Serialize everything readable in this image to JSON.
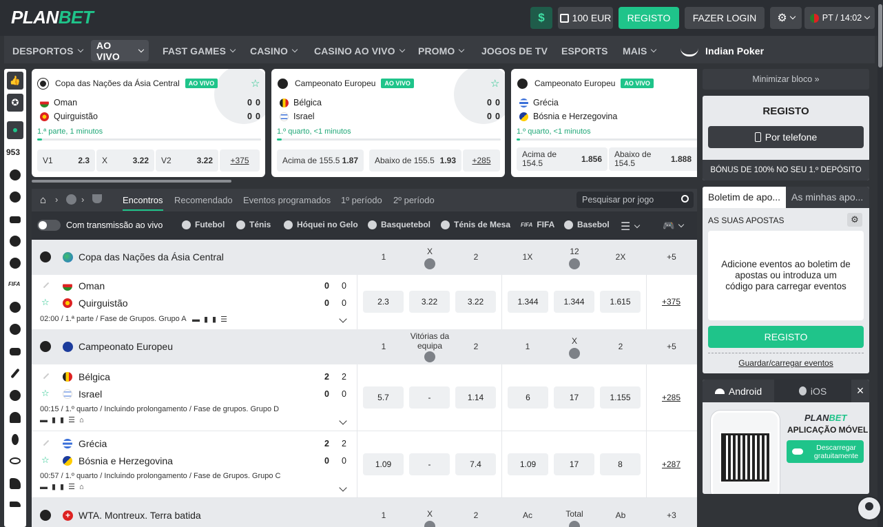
{
  "header": {
    "logo_main": "PLAN",
    "logo_accent": "BET",
    "bonus": "100 EUR",
    "register": "REGISTO",
    "login": "FAZER LOGIN",
    "lang_time": "PT / 14:02"
  },
  "nav": {
    "items": [
      "DESPORTOS",
      "AO VIVO",
      "FAST GAMES",
      "CASINO",
      "CASINO AO VIVO",
      "PROMO",
      "JOGOS DE TV",
      "ESPORTS",
      "MAIS"
    ],
    "indian_poker": "Indian Poker"
  },
  "rail": {
    "count": "953"
  },
  "cards": [
    {
      "league": "Copa das Nações da Ásia Central",
      "badge": "AO VIVO",
      "team1": "Oman",
      "team2": "Quirguistão",
      "s1a": "0",
      "s1b": "0",
      "s2a": "0",
      "s2b": "0",
      "period": "1.ª parte, 1 minutos",
      "b1l": "V1",
      "b1v": "2.3",
      "b2l": "X",
      "b2v": "3.22",
      "b3l": "V2",
      "b3v": "3.22",
      "more": "+375",
      "progress": 0.02
    },
    {
      "league": "Campeonato Europeu",
      "badge": "AO VIVO",
      "team1": "Bélgica",
      "team2": "Israel",
      "s1a": "0",
      "s1b": "0",
      "s2a": "0",
      "s2b": "0",
      "period": "1.º quarto, <1 minutos",
      "b1l": "Acima de 155.5",
      "b1v": "1.87",
      "b2l": "Abaixo de 155.5",
      "b2v": "1.93",
      "more": "+285",
      "progress": 0.01
    },
    {
      "league": "Campeonato Europeu",
      "badge": "AO VIVO",
      "team1": "Grécia",
      "team2": "Bósnia e Herzegovina",
      "period": "1.º quarto, <1 minutos",
      "b1l": "Acima de 154.5",
      "b1v": "1.856",
      "b2l": "Abaixo de 154.5",
      "b2v": "1.888",
      "progress": 0.01
    }
  ],
  "tabs": {
    "items": [
      "Encontros",
      "Recomendado",
      "Eventos programados",
      "1º período",
      "2º período"
    ],
    "search_placeholder": "Pesquisar por jogo"
  },
  "filters": {
    "stream": "Com transmissão ao vivo",
    "sports": [
      "Futebol",
      "Ténis",
      "Hóquei no Gelo",
      "Basquetebol",
      "Ténis de Mesa",
      "FIFA",
      "Basebol"
    ]
  },
  "leagues": [
    {
      "name": "Copa das Nações da Ásia Central",
      "cols": [
        "1",
        "X",
        "2",
        "1X",
        "12",
        "2X",
        "+5"
      ]
    },
    {
      "name": "Campeonato Europeu",
      "cols": [
        "1",
        "Vitórias da equipa",
        "2",
        "1",
        "X",
        "2",
        "+5"
      ]
    },
    {
      "name": "WTA. Montreux. Terra batida",
      "cols": [
        "1",
        "X",
        "2",
        "Ac",
        "Total",
        "Ab",
        "+3"
      ]
    }
  ],
  "matches": [
    {
      "team1": "Oman",
      "team2": "Quirguistão",
      "s1a": "0",
      "s1b": "0",
      "s2a": "0",
      "s2b": "0",
      "info": "02:00 / 1.ª parte / Fase de Grupos. Grupo A",
      "odds": [
        "2.3",
        "3.22",
        "3.22",
        "1.344",
        "1.344",
        "1.615"
      ],
      "more": "+375"
    },
    {
      "team1": "Bélgica",
      "team2": "Israel",
      "s1a": "2",
      "s1b": "2",
      "s2a": "0",
      "s2b": "0",
      "info": "00:15 / 1.º quarto / Incluindo prolongamento / Fase de grupos. Grupo D",
      "odds": [
        "5.7",
        "-",
        "1.14",
        "6",
        "17",
        "1.155"
      ],
      "more": "+285"
    },
    {
      "team1": "Grécia",
      "team2": "Bósnia e Herzegovina",
      "s1a": "2",
      "s1b": "2",
      "s2a": "0",
      "s2b": "0",
      "info": "00:57 / 1.º quarto / Incluindo prolongamento / Fase de Grupos. Grupo C",
      "odds": [
        "1.09",
        "-",
        "7.4",
        "1.09",
        "17",
        "8"
      ],
      "more": "+287"
    }
  ],
  "right": {
    "minimize": "Minimizar bloco »",
    "reg_title": "REGISTO",
    "by_phone": "Por telefone",
    "bonus_text": "BÓNUS DE 100% NO SEU 1.º DEPÓSITO",
    "slip_tab1": "Boletim de apo...",
    "slip_tab2": "As minhas apo...",
    "your_bets": "AS SUAS APOSTAS",
    "empty_msg": "Adicione eventos ao boletim de apostas ou introduza um código para carregar eventos",
    "reg_btn": "REGISTO",
    "save_load": "Guardar/carregar eventos",
    "android": "Android",
    "ios": "iOS",
    "app_logo_main": "PLAN",
    "app_logo_accent": "BET",
    "app_title": "APLICAÇÃO MÓVEL",
    "download": "Descarregar gratuitamente"
  },
  "colors": {
    "accent": "#1fc48a",
    "dark": "#2b2e33"
  }
}
